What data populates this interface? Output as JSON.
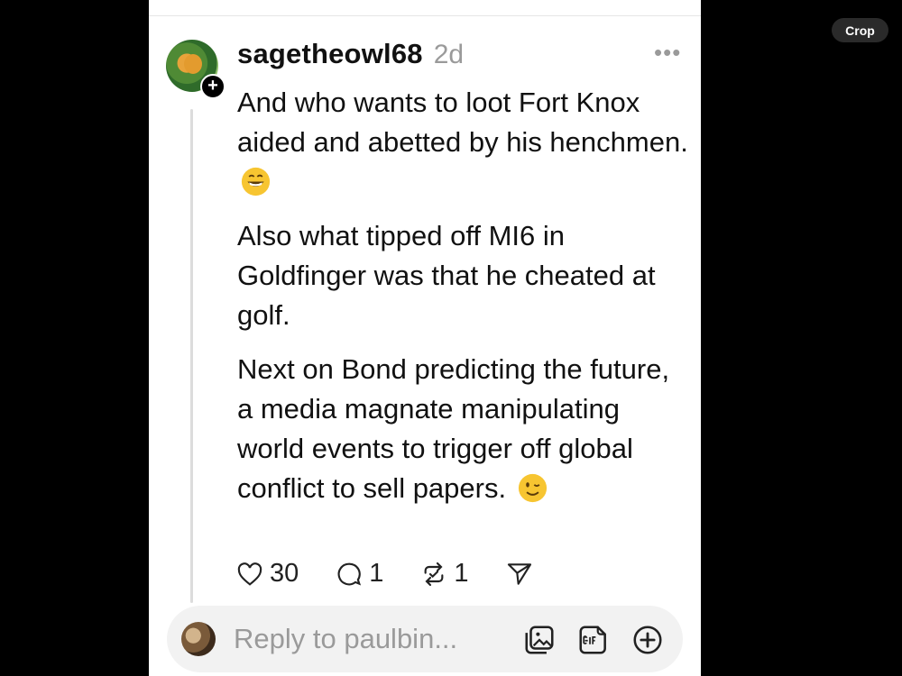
{
  "overlay": {
    "crop_label": "Crop"
  },
  "post": {
    "username": "sagetheowl68",
    "timestamp": "2d",
    "more_icon": "more-horizontal-icon",
    "follow_icon": "plus-icon",
    "paragraphs": [
      {
        "text": "And who wants to loot Fort Knox aided and abetted by his henchmen.",
        "emoji": "grinning-face-emoji"
      },
      {
        "text": "Also what tipped off MI6 in Goldfinger was that he cheated at golf."
      },
      {
        "text": "Next on Bond predicting the future, a media magnate manipulating world events to trigger off global conflict to sell papers.",
        "emoji": "winking-face-emoji"
      }
    ],
    "actions": {
      "likes": "30",
      "comments": "1",
      "reposts": "1",
      "share_icon": "send-icon"
    }
  },
  "reply": {
    "placeholder": "Reply to paulbin...",
    "icons": [
      "gallery-icon",
      "gif-icon",
      "add-circle-icon"
    ]
  }
}
